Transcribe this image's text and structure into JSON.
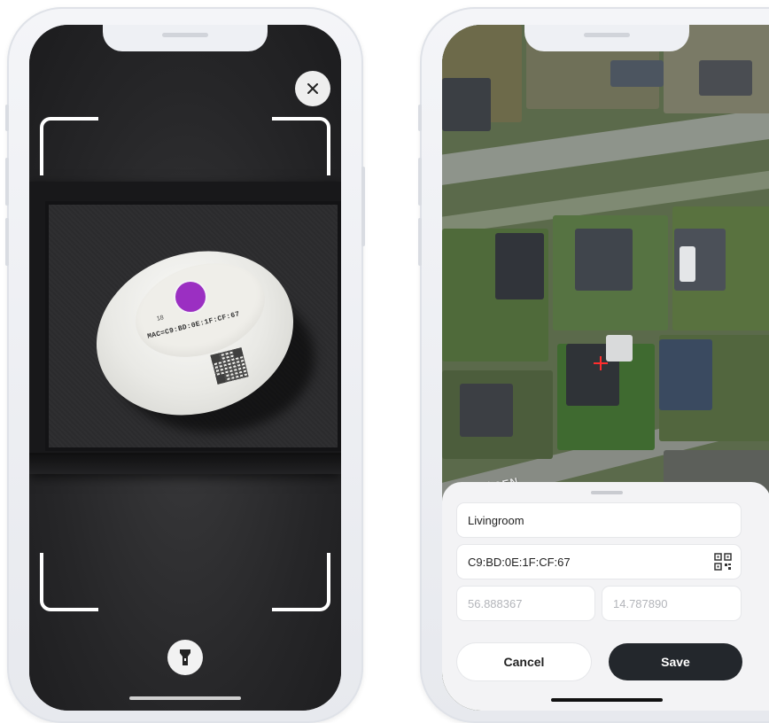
{
  "scanner": {
    "close_icon": "close-icon",
    "torch_icon": "flashlight-icon",
    "sensor_label_mac": "MAC=C9:BD:0E:1F:CF:67",
    "sensor_label_num": "18"
  },
  "map_screen": {
    "map_labels": [
      "ÄGEN"
    ],
    "form": {
      "name_value": "Livingroom",
      "mac_value": "C9:BD:0E:1F:CF:67",
      "latitude_placeholder": "56.888367",
      "longitude_placeholder": "14.787890",
      "qr_icon": "qr-scan-icon"
    },
    "buttons": {
      "cancel_label": "Cancel",
      "save_label": "Save"
    }
  },
  "colors": {
    "save_button": "#23272c",
    "crosshair": "#ff2d2d",
    "sensor_dot": "#9b2fc2"
  }
}
